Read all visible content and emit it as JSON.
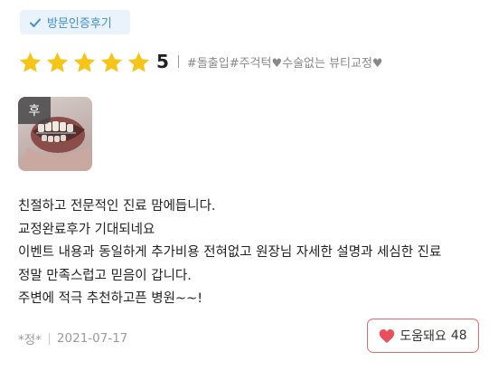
{
  "badge": {
    "label": "방문인증후기",
    "icon": "check-icon",
    "color": "#3f8fd2"
  },
  "rating": {
    "stars": 5,
    "max_stars": 5,
    "score": "5",
    "star_color": "#f5c518"
  },
  "tags": "#돌출입#주걱턱♥수술없는 뷰티교정♥",
  "photo": {
    "label": "후"
  },
  "review_lines": [
    "친절하고 전문적인 진료 맘에듭니다.",
    "교정완료후가 기대되네요",
    "이벤트 내용과 동일하게 추가비용 전혀없고 원장님 자세한 설명과 세심한 진료",
    "정말 만족스럽고 믿음이 갑니다.",
    "주변에 적극 추천하고픈 병원~~!"
  ],
  "meta": {
    "author": "*정*",
    "date": "2021-07-17"
  },
  "helpful": {
    "label": "도움돼요",
    "count": "48",
    "icon": "heart-icon",
    "color": "#e8505b"
  }
}
